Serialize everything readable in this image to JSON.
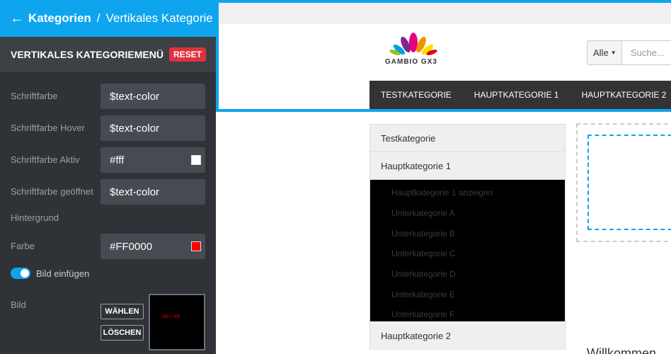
{
  "header": {
    "back_icon": "arrow-left-icon",
    "crumb_main": "Kategorien",
    "separator": "/",
    "crumb_current": "Vertikales Kategorie"
  },
  "panel": {
    "title": "VERTIKALES KATEGORIEMENÜ",
    "reset_label": "RESET",
    "fields": {
      "font_color": {
        "label": "Schriftfarbe",
        "value": "$text-color"
      },
      "font_color_hover": {
        "label": "Schriftfarbe Hover",
        "value": "$text-color"
      },
      "font_color_active": {
        "label": "Schriftfarbe Aktiv",
        "value": "#fff",
        "swatch": "#ffffff"
      },
      "font_color_open": {
        "label": "Schriftfarbe geöffnet",
        "value": "$text-color"
      },
      "background_heading": "Hintergrund",
      "bg_color": {
        "label": "Farbe",
        "value": "#FF0000",
        "swatch": "#ff0000"
      },
      "insert_image": {
        "label": "Bild einfügen",
        "enabled": true
      },
      "image": {
        "label": "Bild",
        "choose_label": "WÄHLEN",
        "delete_label": "LÖSCHEN",
        "preview_text": "160 x 100"
      }
    }
  },
  "shop": {
    "logo_text": "GAMBIO GX3",
    "search": {
      "select_value": "Alle",
      "placeholder": "Suche..."
    },
    "nav": [
      "TESTKATEGORIE",
      "HAUPTKATEGORIE 1",
      "HAUPTKATEGORIE 2"
    ],
    "vertical_menu": {
      "items": [
        "Testkategorie",
        "Hauptkategorie 1"
      ],
      "subitems": [
        "Hauptkategorie 1 anzeigen",
        "Unterkategorie A",
        "Unterkategorie B",
        "Unterkategorie C",
        "Unterkategorie D",
        "Unterkategorie E",
        "Unterkategorie F"
      ],
      "last_item": "Hauptkategorie 2"
    },
    "welcome_text": "Willkommen"
  },
  "colors": {
    "accent": "#0ea5ee",
    "reset": "#e0313f",
    "panel_bg": "#2f3337",
    "navbar": "#333333"
  }
}
